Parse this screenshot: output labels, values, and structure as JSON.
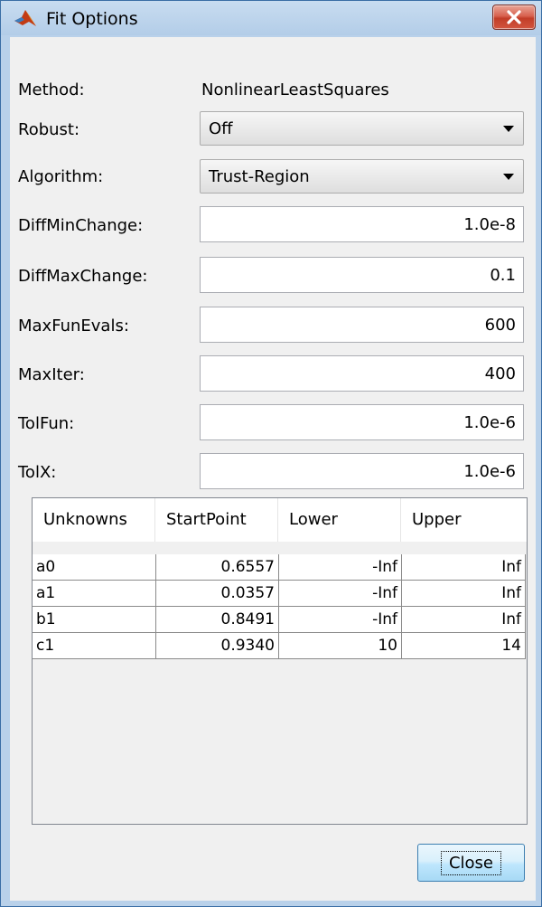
{
  "window": {
    "title": "Fit Options"
  },
  "fields": {
    "method": {
      "label": "Method:",
      "value": "NonlinearLeastSquares"
    },
    "robust": {
      "label": "Robust:",
      "value": "Off"
    },
    "algorithm": {
      "label": "Algorithm:",
      "value": "Trust-Region"
    },
    "diff_min_change": {
      "label": "DiffMinChange:",
      "value": "1.0e-8"
    },
    "diff_max_change": {
      "label": "DiffMaxChange:",
      "value": "0.1"
    },
    "max_fun_evals": {
      "label": "MaxFunEvals:",
      "value": "600"
    },
    "max_iter": {
      "label": "MaxIter:",
      "value": "400"
    },
    "tol_fun": {
      "label": "TolFun:",
      "value": "1.0e-6"
    },
    "tol_x": {
      "label": "TolX:",
      "value": "1.0e-6"
    }
  },
  "table": {
    "headers": [
      "Unknowns",
      "StartPoint",
      "Lower",
      "Upper"
    ],
    "rows": [
      [
        "a0",
        "0.6557",
        "-Inf",
        "Inf"
      ],
      [
        "a1",
        "0.0357",
        "-Inf",
        "Inf"
      ],
      [
        "b1",
        "0.8491",
        "-Inf",
        "Inf"
      ],
      [
        "c1",
        "0.9340",
        "10",
        "14"
      ]
    ]
  },
  "buttons": {
    "close_label": "Close"
  },
  "colors": {
    "titlebar": "#b9d1ea",
    "panel": "#f0f0f0",
    "close_x_button": "#c7402b"
  }
}
